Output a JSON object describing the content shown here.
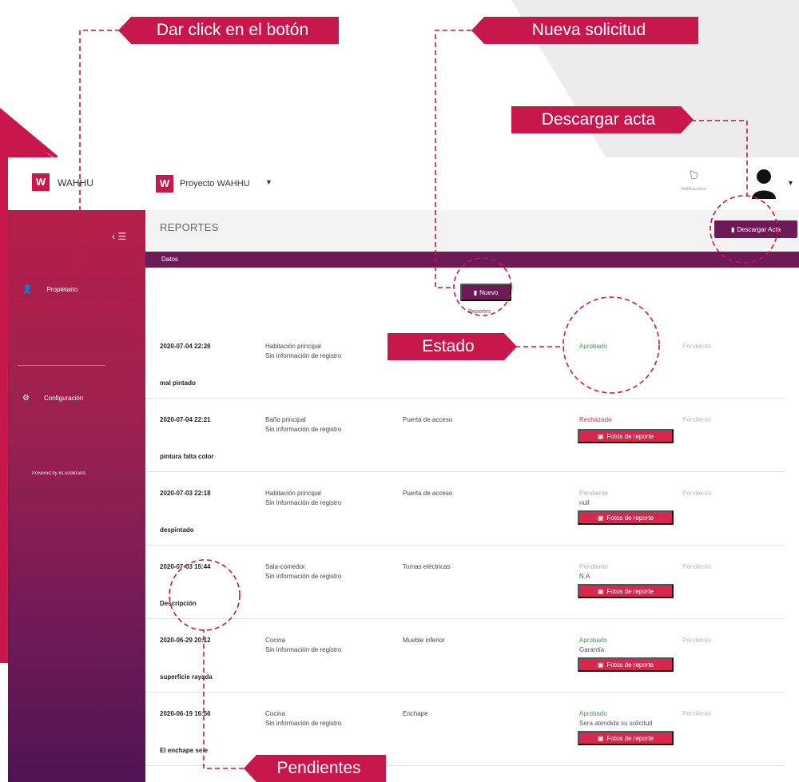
{
  "colors": {
    "brand": "#c8174a",
    "header_purple": "#6e1a57",
    "approved": "#3aa447",
    "rejected": "#d8274f",
    "pending": "#b0b0b0"
  },
  "topbar": {
    "brand": "WAHHU",
    "project": "Proyecto WAHHU",
    "notifications_label": "Notificaciones"
  },
  "sidebar": {
    "items": [
      {
        "label": "Propietario",
        "icon": "user-icon"
      },
      {
        "label": "Configuración",
        "icon": "gear-icon"
      }
    ],
    "powered": "Powered by BLoodBrand"
  },
  "main": {
    "title": "REPORTES",
    "download_label": "Descargar Acta",
    "panel_title": "Datos",
    "new_label": "Nuevo",
    "reports_label": "Reportes"
  },
  "rows": [
    {
      "date": "2020-07-04 22:26",
      "room": "Habitación principal",
      "info": "Sin información de registro",
      "item": "",
      "status": "Aprobado",
      "status_type": "approved",
      "note": "",
      "pending": "Pendiente",
      "description": "mal pintado",
      "fotos": ""
    },
    {
      "date": "2020-07-04 22:21",
      "room": "Baño principal",
      "info": "Sin información de registro",
      "item": "Puerta de acceso",
      "status": "Rechazado",
      "status_type": "rejected",
      "note": "",
      "pending": "Pendiente",
      "description": "pintura falta color",
      "fotos": "Fotos de reporte"
    },
    {
      "date": "2020-07-03 22:18",
      "room": "Habitación principal",
      "info": "Sin información de registro",
      "item": "Puerta de acceso",
      "status": "Pendiente",
      "status_type": "pending",
      "note": "null",
      "pending": "Pendiente",
      "description": "despintado",
      "fotos": "Fotos de reporte"
    },
    {
      "date": "2020-07-03 15:44",
      "room": "Sala-comedor",
      "info": "Sin información de registro",
      "item": "Tomas eléctricas",
      "status": "Pendiente",
      "status_type": "pending",
      "note": "N.A",
      "pending": "Pendiente",
      "description": "Descripción",
      "fotos": "Fotos de reporte"
    },
    {
      "date": "2020-06-29 20:12",
      "room": "Cocina",
      "info": "Sin información de registro",
      "item": "Mueble inferior",
      "status": "Aprobado",
      "status_type": "approved",
      "note": "Garantía",
      "pending": "Pendiente",
      "description": "superficie rayada",
      "fotos": "Fotos de reporte"
    },
    {
      "date": "2020-06-19 16:56",
      "room": "Cocina",
      "info": "Sin información de registro",
      "item": "Enchape",
      "status": "Aprobado",
      "status_type": "approved",
      "note": "Sera atendida su solicitud",
      "pending": "Pendiente",
      "description": "El enchape se e",
      "fotos": "Fotos de reporte"
    }
  ],
  "annotations": {
    "click": "Dar click en el botón",
    "nueva": "Nueva solicitud",
    "descargar": "Descargar acta",
    "estado": "Estado",
    "pendientes": "Pendientes"
  }
}
